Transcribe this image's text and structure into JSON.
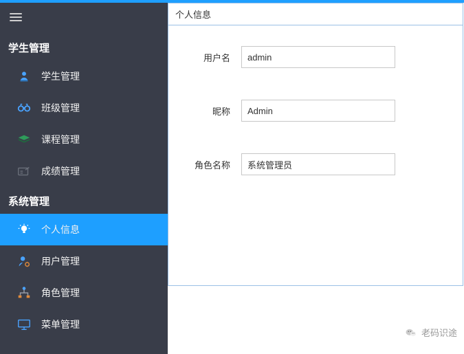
{
  "sidebar": {
    "sections": [
      {
        "title": "学生管理",
        "items": [
          {
            "label": "学生管理"
          },
          {
            "label": "班级管理"
          },
          {
            "label": "课程管理"
          },
          {
            "label": "成绩管理"
          }
        ]
      },
      {
        "title": "系统管理",
        "items": [
          {
            "label": "个人信息"
          },
          {
            "label": "用户管理"
          },
          {
            "label": "角色管理"
          },
          {
            "label": "菜单管理"
          }
        ]
      }
    ]
  },
  "panel": {
    "title": "个人信息",
    "fields": {
      "username_label": "用户名",
      "username_value": "admin",
      "nickname_label": "昵称",
      "nickname_value": "Admin",
      "role_label": "角色名称",
      "role_value": "系统管理员"
    }
  },
  "watermark": {
    "text": "老码识途"
  }
}
